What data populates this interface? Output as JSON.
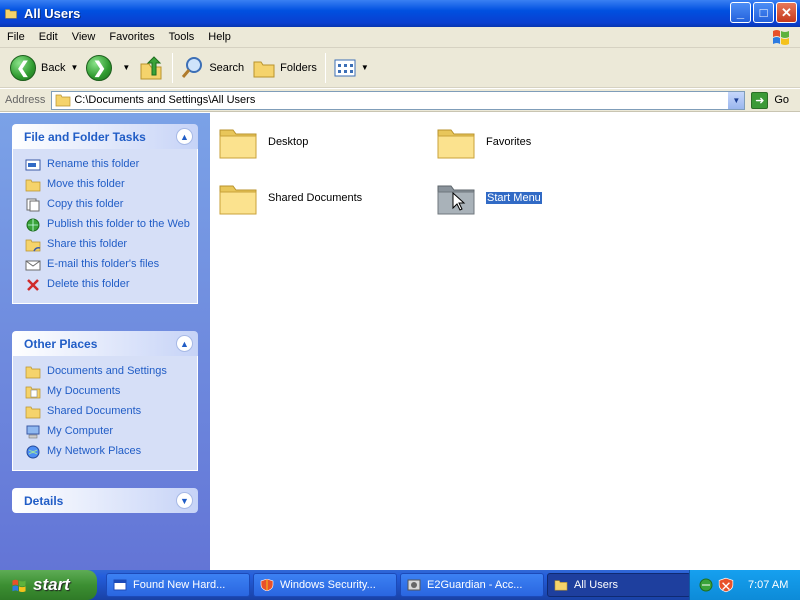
{
  "window": {
    "title": "All Users",
    "controls": {
      "minimize": "_",
      "maximize": "□",
      "close": "✕"
    }
  },
  "menu": [
    "File",
    "Edit",
    "View",
    "Favorites",
    "Tools",
    "Help"
  ],
  "toolbar": {
    "back": "Back",
    "search": "Search",
    "folders": "Folders"
  },
  "address": {
    "label": "Address",
    "value": "C:\\Documents and Settings\\All Users",
    "go": "Go"
  },
  "sidebar": {
    "tasks": {
      "title": "File and Folder Tasks",
      "items": [
        {
          "label": "Rename this folder",
          "icon": "rename-icon"
        },
        {
          "label": "Move this folder",
          "icon": "move-icon"
        },
        {
          "label": "Copy this folder",
          "icon": "copy-icon"
        },
        {
          "label": "Publish this folder to the Web",
          "icon": "publish-web-icon"
        },
        {
          "label": "Share this folder",
          "icon": "share-icon"
        },
        {
          "label": "E-mail this folder's files",
          "icon": "email-icon"
        },
        {
          "label": "Delete this folder",
          "icon": "delete-icon"
        }
      ]
    },
    "places": {
      "title": "Other Places",
      "items": [
        {
          "label": "Documents and Settings",
          "icon": "folder-icon"
        },
        {
          "label": "My Documents",
          "icon": "my-documents-icon"
        },
        {
          "label": "Shared Documents",
          "icon": "folder-icon"
        },
        {
          "label": "My Computer",
          "icon": "computer-icon"
        },
        {
          "label": "My Network Places",
          "icon": "network-icon"
        }
      ]
    },
    "details": {
      "title": "Details"
    }
  },
  "folders": [
    {
      "name": "Desktop",
      "selected": false
    },
    {
      "name": "Favorites",
      "selected": false
    },
    {
      "name": "Shared Documents",
      "selected": false
    },
    {
      "name": "Start Menu",
      "selected": true
    }
  ],
  "taskbar": {
    "start": "start",
    "tasks": [
      {
        "label": "Found New Hard...",
        "icon": "window-icon",
        "active": false
      },
      {
        "label": "Windows Security...",
        "icon": "security-shield-icon",
        "active": false
      },
      {
        "label": "E2Guardian - Acc...",
        "icon": "app-icon",
        "active": false
      },
      {
        "label": "All Users",
        "icon": "folder-icon",
        "active": true
      }
    ],
    "clock": "7:07 AM"
  },
  "colors": {
    "titlebar": "#0a3fd0",
    "selection": "#316ac5",
    "link": "#215dc6",
    "sidebar": "#6f8fdf"
  }
}
